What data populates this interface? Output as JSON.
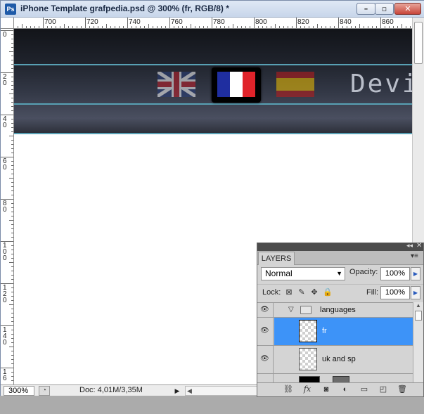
{
  "window": {
    "app_icon": "Ps",
    "title": "iPhone Template grafpedia.psd @ 300% (fr, RGB/8) *",
    "controls": [
      "minimize-icon",
      "maximize-icon",
      "close-icon"
    ]
  },
  "rulers": {
    "horizontal_labels": [
      "700",
      "720",
      "740",
      "760",
      "780",
      "800",
      "820",
      "840",
      "860"
    ],
    "vertical_labels": [
      "0",
      "20",
      "40",
      "60",
      "80",
      "100",
      "120",
      "140",
      "16"
    ]
  },
  "canvas": {
    "brand_text": "Devis",
    "flags": [
      "uk-flag-icon",
      "france-flag-icon",
      "spain-flag-icon"
    ],
    "colors": {
      "guide": "#58a0b4",
      "banner_dark": "#121419",
      "banner_mid": "#333846"
    }
  },
  "status": {
    "zoom": "300%",
    "doc": "Doc: 4,01M/3,35M",
    "arrow": "▶"
  },
  "layers_panel": {
    "tab": "LAYERS",
    "blend_mode": "Normal",
    "opacity_label": "Opacity:",
    "opacity": "100%",
    "lock_label": "Lock:",
    "fill_label": "Fill:",
    "fill": "100%",
    "layers": [
      {
        "name": "languages",
        "type": "group",
        "expanded": true,
        "visible": true
      },
      {
        "name": "fr",
        "selected": true,
        "visible": true
      },
      {
        "name": "uk and sp",
        "visible": true
      }
    ],
    "colors": {
      "selection": "#3d93f8"
    }
  }
}
